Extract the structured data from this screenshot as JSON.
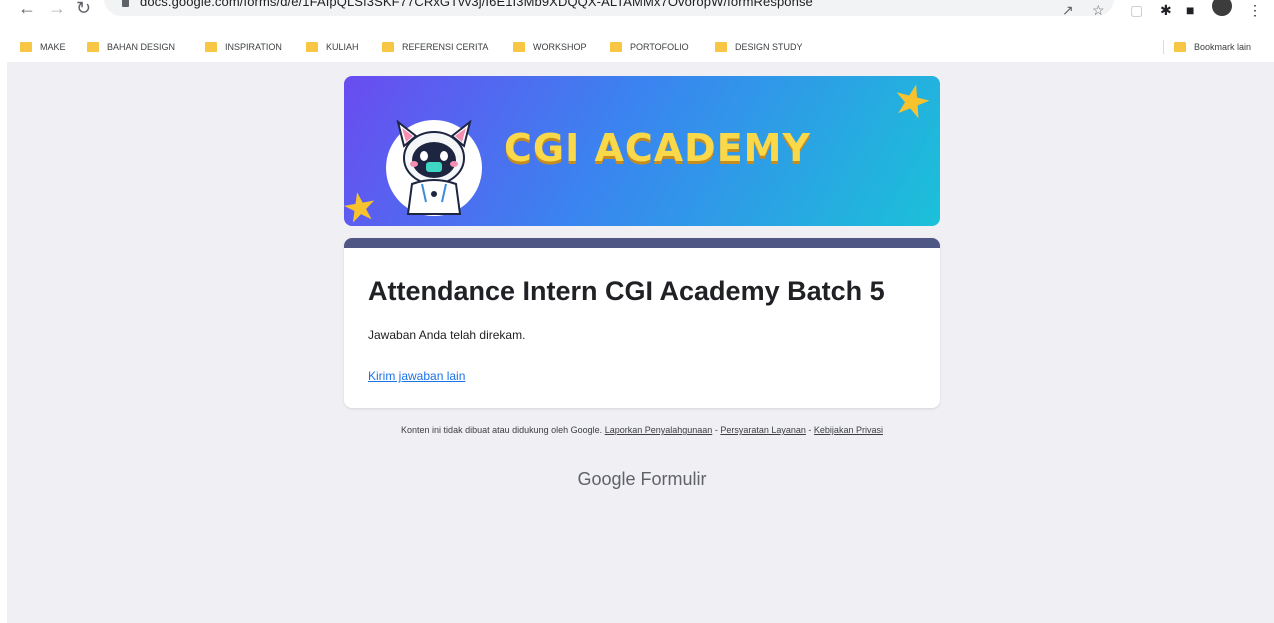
{
  "browser": {
    "url": "docs.google.com/forms/d/e/1FAIpQLSf3SKF77CRxGTvv3j/I6E1I3Mb9XDQQX-ALTAMMx7OvoropW/formResponse"
  },
  "bookmarks": [
    {
      "label": "MAKE"
    },
    {
      "label": "BAHAN DESIGN"
    },
    {
      "label": "INSPIRATION"
    },
    {
      "label": "KULIAH"
    },
    {
      "label": "REFERENSI CERITA"
    },
    {
      "label": "WORKSHOP"
    },
    {
      "label": "PORTOFOLIO"
    },
    {
      "label": "DESIGN STUDY"
    }
  ],
  "other_bookmarks": "Bookmark lain",
  "banner": {
    "title": "CGI ACADEMY"
  },
  "form": {
    "title": "Attendance Intern CGI Academy Batch 5",
    "message": "Jawaban Anda telah direkam.",
    "another_response_link": "Kirim jawaban lain"
  },
  "footer": {
    "disclaimer": "Konten ini tidak dibuat atau didukung oleh Google.",
    "report_abuse": "Laporkan Penyalahgunaan",
    "separator": "-",
    "terms": "Persyaratan Layanan",
    "privacy": "Kebijakan Privasi",
    "brand_google": "Google",
    "brand_product": "Formulir"
  },
  "colors": {
    "page_bg": "#f0eff4",
    "card_accent": "#4f5884",
    "link": "#1a73e8",
    "banner_title": "#f9d94a"
  }
}
